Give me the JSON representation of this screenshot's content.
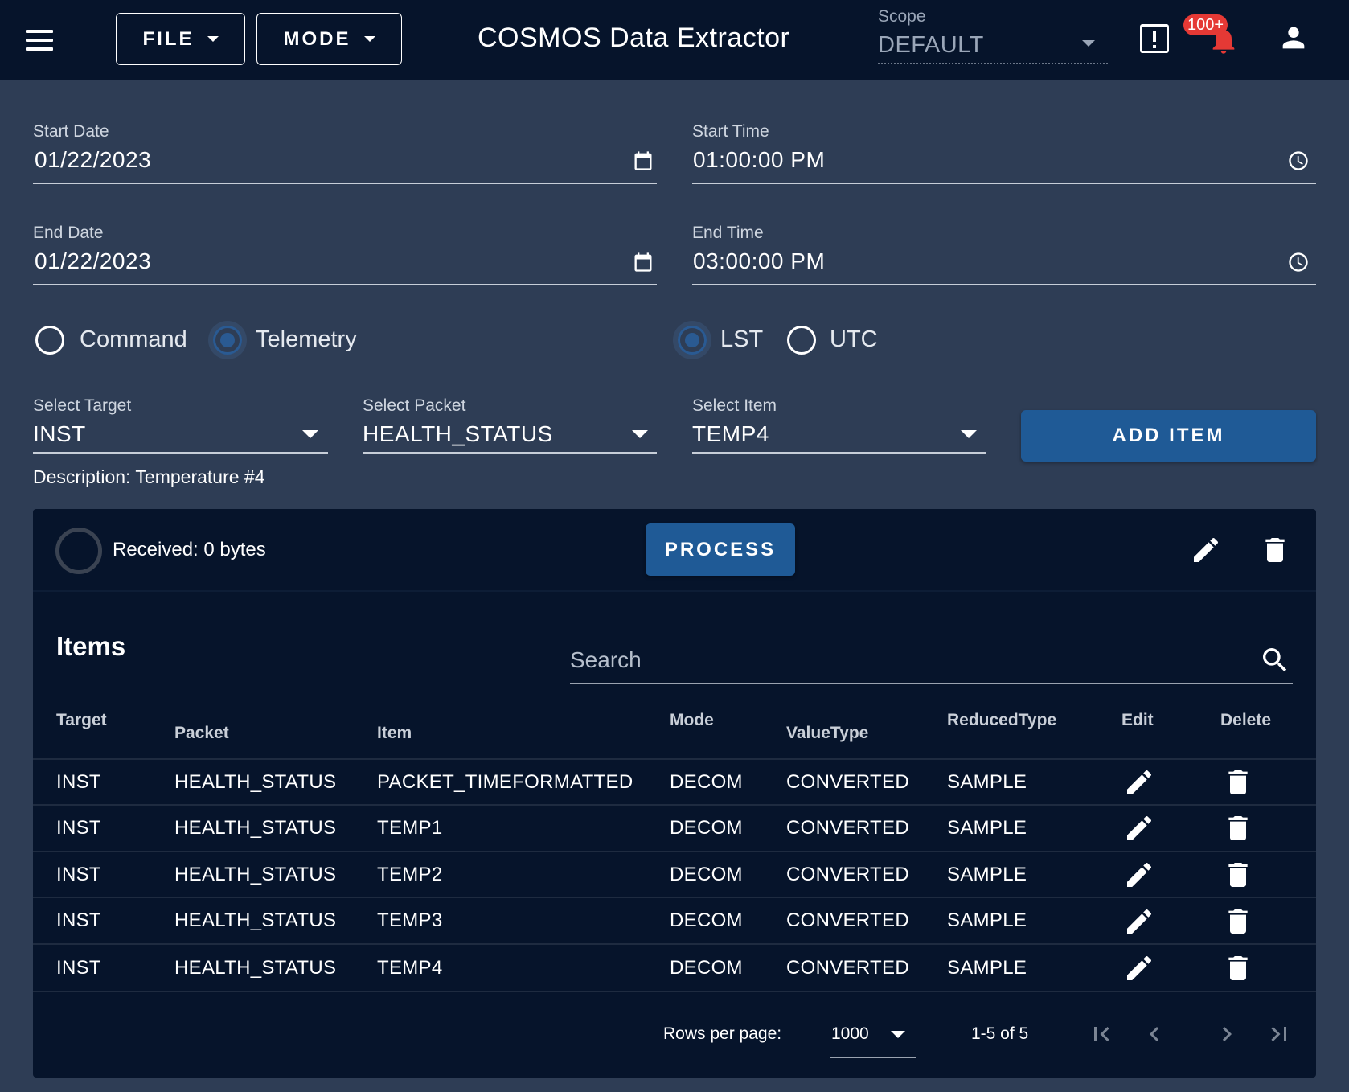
{
  "appbar": {
    "file_label": "FILE",
    "mode_label": "MODE",
    "title": "COSMOS Data Extractor",
    "scope_label": "Scope",
    "scope_value": "DEFAULT",
    "notification_badge": "100+"
  },
  "form": {
    "start_date_label": "Start Date",
    "start_date": "01/22/2023",
    "start_time_label": "Start Time",
    "start_time": "01:00:00 PM",
    "end_date_label": "End Date",
    "end_date": "01/22/2023",
    "end_time_label": "End Time",
    "end_time": "03:00:00 PM",
    "radio_command": "Command",
    "radio_telemetry": "Telemetry",
    "radio_lst": "LST",
    "radio_utc": "UTC",
    "target_label": "Select Target",
    "target_value": "INST",
    "packet_label": "Select Packet",
    "packet_value": "HEALTH_STATUS",
    "item_label": "Select Item",
    "item_value": "TEMP4",
    "add_item": "ADD ITEM",
    "description": "Description: Temperature #4"
  },
  "process": {
    "received": "Received: 0 bytes",
    "process_label": "PROCESS"
  },
  "items_table": {
    "title": "Items",
    "search_placeholder": "Search",
    "headers": [
      "Target",
      "Packet",
      "Item",
      "Mode",
      "ValueType",
      "ReducedType",
      "Edit",
      "Delete"
    ],
    "rows": [
      [
        "INST",
        "HEALTH_STATUS",
        "PACKET_TIMEFORMATTED",
        "DECOM",
        "CONVERTED",
        "SAMPLE"
      ],
      [
        "INST",
        "HEALTH_STATUS",
        "TEMP1",
        "DECOM",
        "CONVERTED",
        "SAMPLE"
      ],
      [
        "INST",
        "HEALTH_STATUS",
        "TEMP2",
        "DECOM",
        "CONVERTED",
        "SAMPLE"
      ],
      [
        "INST",
        "HEALTH_STATUS",
        "TEMP3",
        "DECOM",
        "CONVERTED",
        "SAMPLE"
      ],
      [
        "INST",
        "HEALTH_STATUS",
        "TEMP4",
        "DECOM",
        "CONVERTED",
        "SAMPLE"
      ]
    ],
    "rows_per_page_label": "Rows per page:",
    "rows_per_page_value": "1000",
    "page_info": "1-5 of 5"
  }
}
